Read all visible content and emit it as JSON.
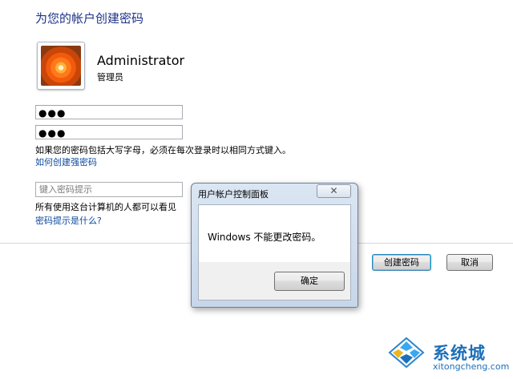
{
  "page": {
    "title": "为您的帐户创建密码"
  },
  "user": {
    "name": "Administrator",
    "role": "管理员"
  },
  "form": {
    "password": "●●●",
    "confirm_password": "●●●",
    "case_note": "如果您的密码包括大写字母，必须在每次登录时以相同方式键入。",
    "strong_password_link": "如何创建强密码",
    "hint_placeholder": "键入密码提示",
    "hint_note": "所有使用这台计算机的人都可以看见",
    "hint_link": "密码提示是什么?"
  },
  "buttons": {
    "create": "创建密码",
    "cancel": "取消"
  },
  "dialog": {
    "title": "用户帐户控制面板",
    "close": "✕",
    "message": "Windows 不能更改密码。",
    "ok": "确定"
  },
  "watermark": {
    "title": "系统城",
    "url": "xitongcheng.com"
  }
}
